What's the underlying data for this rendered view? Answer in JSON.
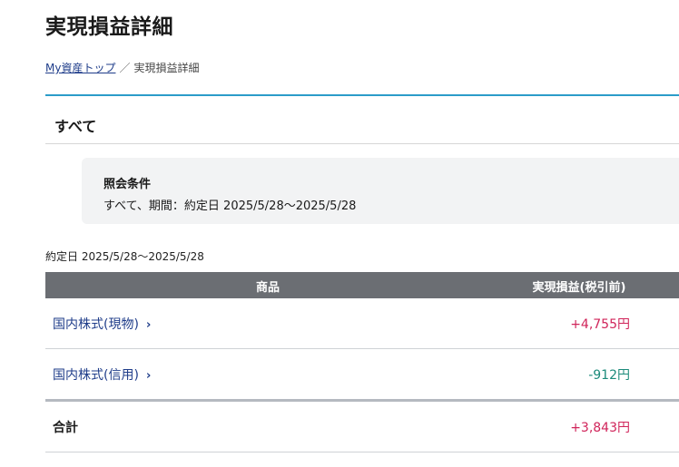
{
  "page": {
    "title": "実現損益詳細"
  },
  "breadcrumb": {
    "link": "My資産トップ",
    "separator": "／",
    "current": "実現損益詳細"
  },
  "section": {
    "title": "すべて"
  },
  "conditions": {
    "label": "照会条件",
    "text": "すべて、期間：約定日 2025/5/28〜2025/5/28"
  },
  "date_range": "約定日 2025/5/28〜2025/5/28",
  "table": {
    "headers": {
      "product": "商品",
      "pl": "実現損益(税引前)"
    },
    "rows": [
      {
        "name": "国内株式(現物)",
        "chevron": "›",
        "value": "+4,755円"
      },
      {
        "name": "国内株式(信用)",
        "chevron": "›",
        "value": "-912円"
      }
    ],
    "total": {
      "label": "合計",
      "value": "+3,843円"
    }
  },
  "colors": {
    "accent_rule": "#2b9cc9",
    "positive": "#d0245a",
    "negative": "#1b8a7a",
    "link": "#1f3d8a",
    "header_bg": "#6b6e73"
  }
}
